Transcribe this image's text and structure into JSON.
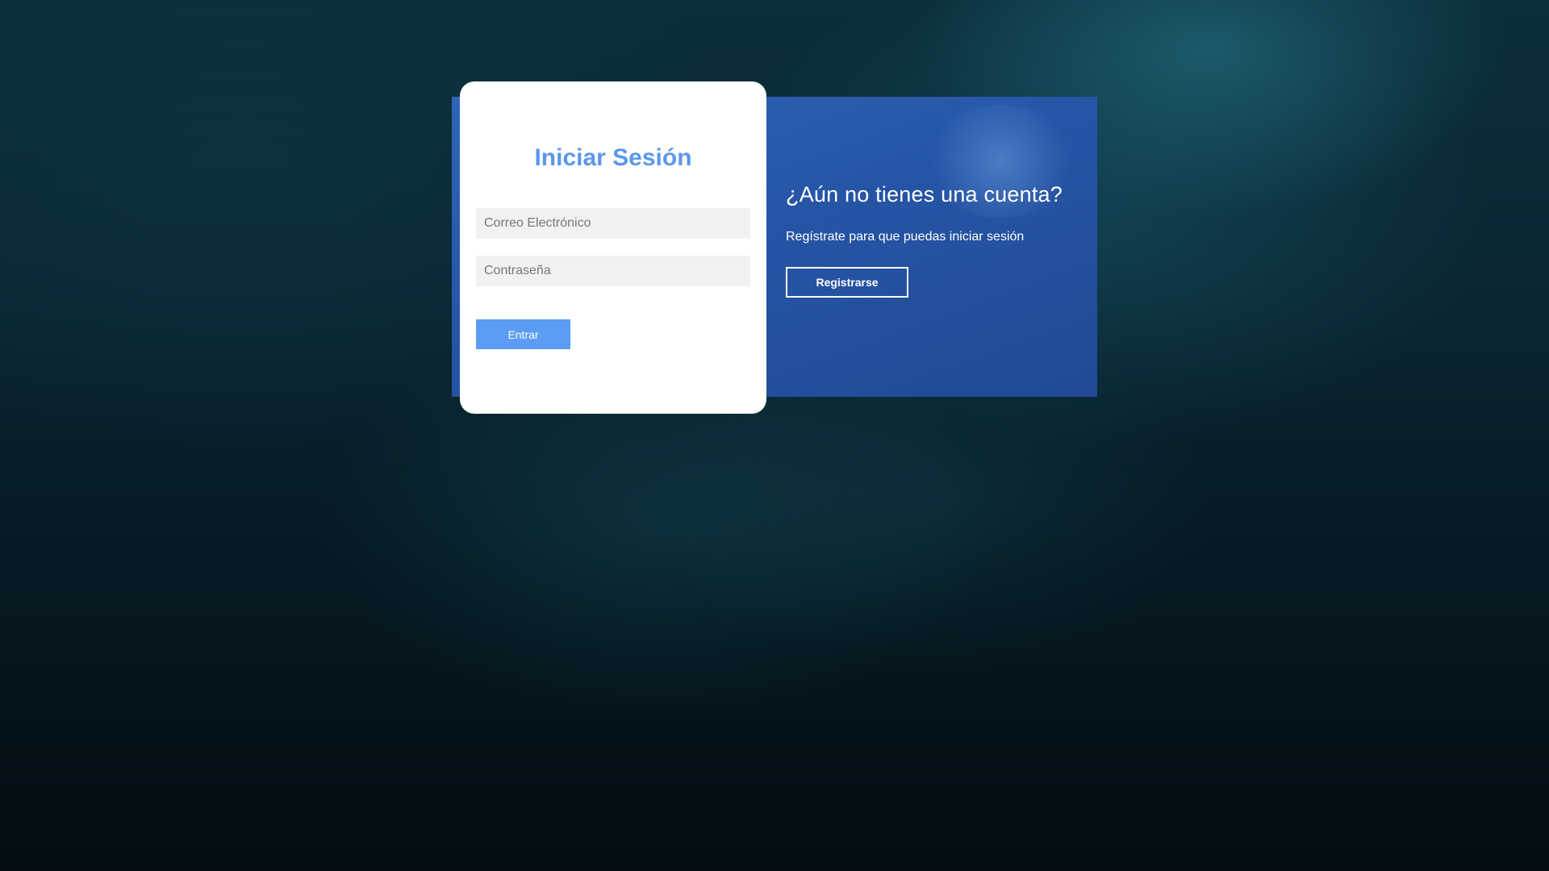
{
  "login": {
    "title": "Iniciar Sesión",
    "email_placeholder": "Correo Electrónico",
    "password_placeholder": "Contraseña",
    "submit_label": "Entrar"
  },
  "register": {
    "title": "¿Aún no tienes una cuenta?",
    "text": "Regístrate para que puedas iniciar sesión",
    "button_label": "Registrarse"
  },
  "colors": {
    "accent": "#5b97ea",
    "submit_button": "#5b9cf5",
    "panel": "#2655a6",
    "field_background": "#f1f1f1"
  }
}
